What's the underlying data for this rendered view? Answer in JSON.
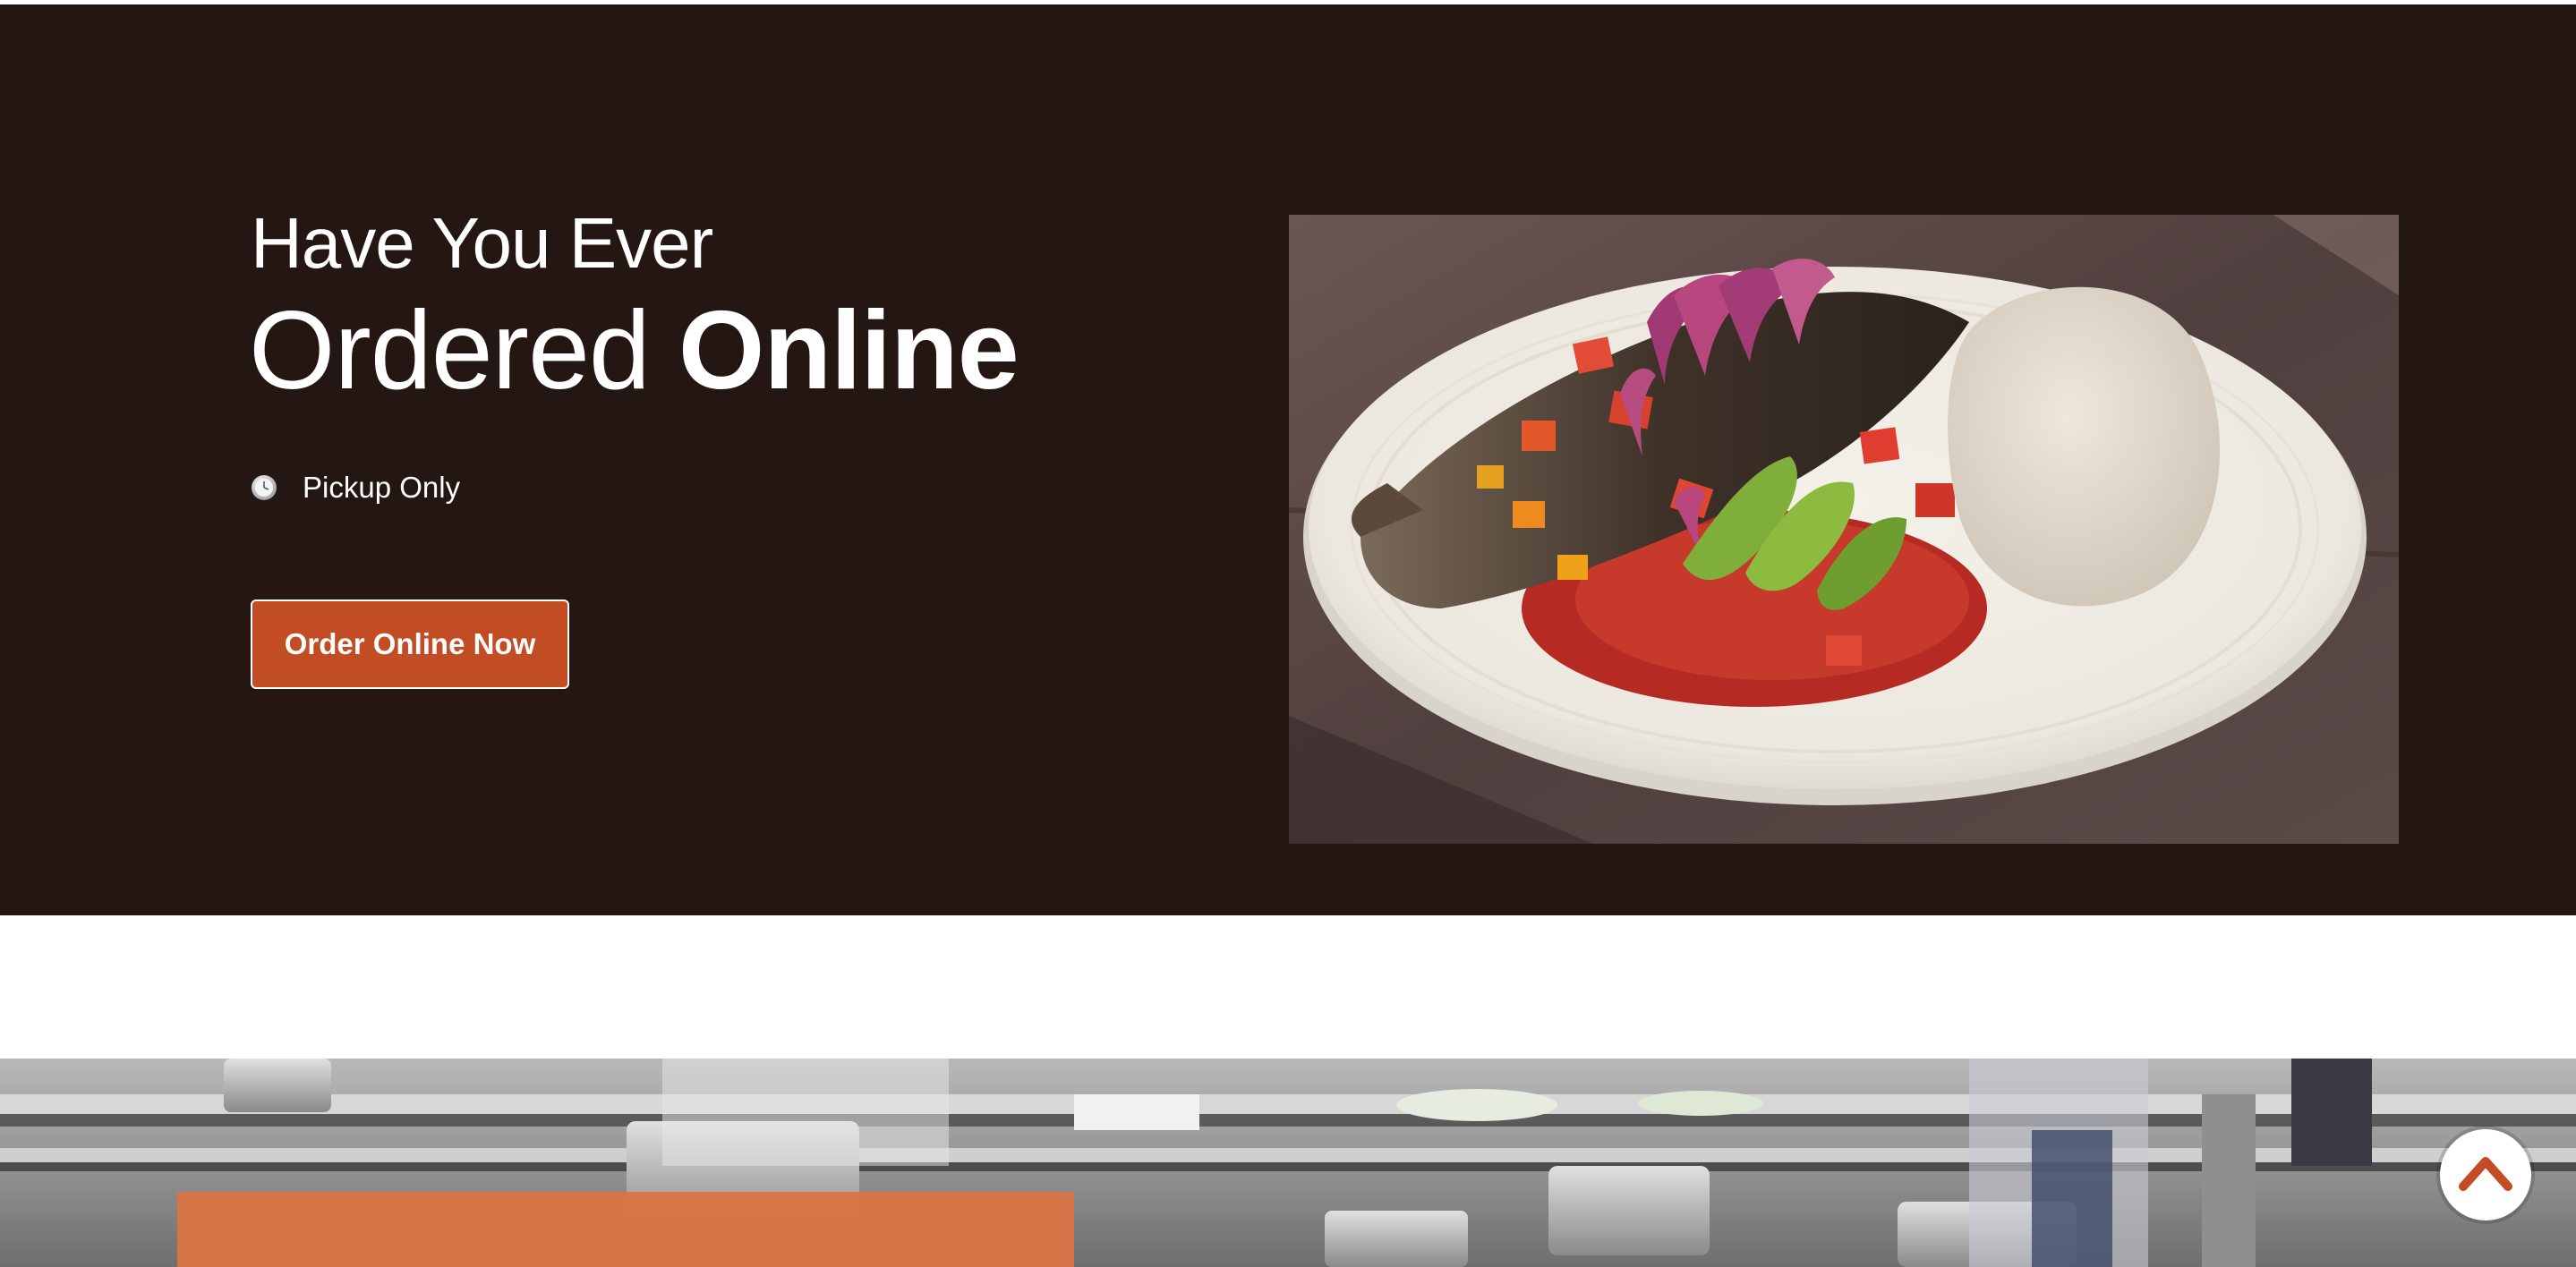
{
  "hero": {
    "line1": "Have You Ever",
    "line2_regular": "Ordered",
    "line2_bold": "Online",
    "pickup_label": "Pickup Only",
    "pickup_icon": "clock-icon",
    "cta_label": "Order Online Now",
    "food_image_alt": "Grilled fish with tomato salsa, onions, avocado and fufu on a white plate"
  },
  "footer_section": {
    "scroll_top_icon": "chevron-up-icon"
  },
  "colors": {
    "hero_background": "#241612",
    "accent": "#c24d25",
    "card_orange": "#d97444",
    "text": "#ffffff"
  }
}
